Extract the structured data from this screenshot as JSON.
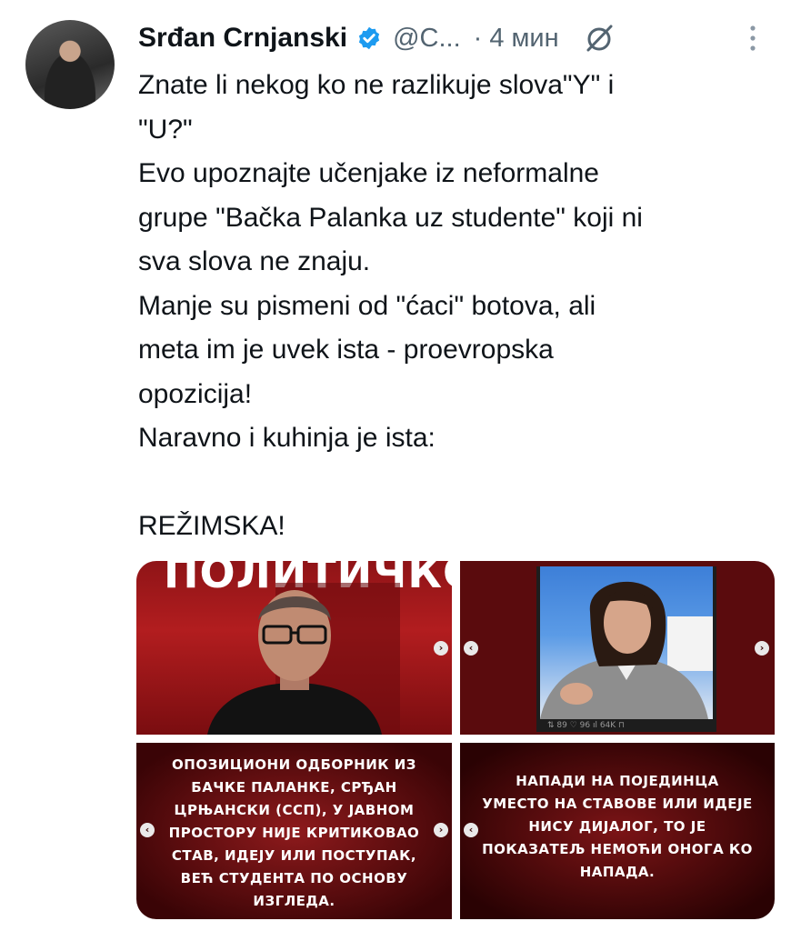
{
  "tweet": {
    "author_name": "Srđan Crnjanski",
    "handle": "@C...",
    "separator": "·",
    "time": "4 мин",
    "text_lines": [
      "Znate li nekog ko ne razlikuje slova\"Y\" i",
      "\"U?\"",
      "Evo upoznajte učenjake iz neformalne",
      "grupe \"Bačka Palanka uz studente\" koji ni",
      "sva slova ne znaju.",
      "Manje su pismeni od \"ćaci\" botova, ali",
      "meta im je uvek ista - proevropska",
      "opozicija!",
      "Naravno i kuhinja je ista:",
      "",
      "REŽIMSKA!"
    ],
    "media": {
      "image1_headline": "ПОЛИТИЧКО",
      "image2_tv_stats": "⇅ 89   ♡ 96   ıl 64K   ⊓",
      "image3_caption": [
        "ОПОЗИЦИОНИ ОДБОРНИК ИЗ",
        "БАЧКЕ ПАЛАНКЕ, СРЂАН",
        "ЦРЊАНСКИ (ССП), У ЈАВНОМ",
        "ПРОСТОРУ НИЈЕ КРИТИКОВАО",
        "СТАВ, ИДЕЈУ ИЛИ ПОСТУПАК,",
        "ВЕЋ СТУДЕНТА ПО ОСНОВУ",
        "ИЗГЛЕДА."
      ],
      "image4_caption": [
        "НАПАДИ НА ПОЈЕДИНЦА",
        "УМЕСТО НА СТАВОВЕ ИЛИ ИДЕЈЕ",
        "НИСУ ДИЈАЛОГ, ТО ЈЕ",
        "ПОКАЗАТЕЉ НЕМОЋИ ОНОГА КО",
        "НАПАДА."
      ]
    }
  },
  "icons": {
    "verified": "verified-badge-icon",
    "grok": "grok-icon",
    "more": "more-vertical-icon",
    "carousel_prev": "chevron-left-icon",
    "carousel_next": "chevron-right-icon"
  },
  "colors": {
    "verified_blue": "#1d9bf0",
    "secondary_text": "#536471",
    "primary_text": "#0f1419"
  }
}
